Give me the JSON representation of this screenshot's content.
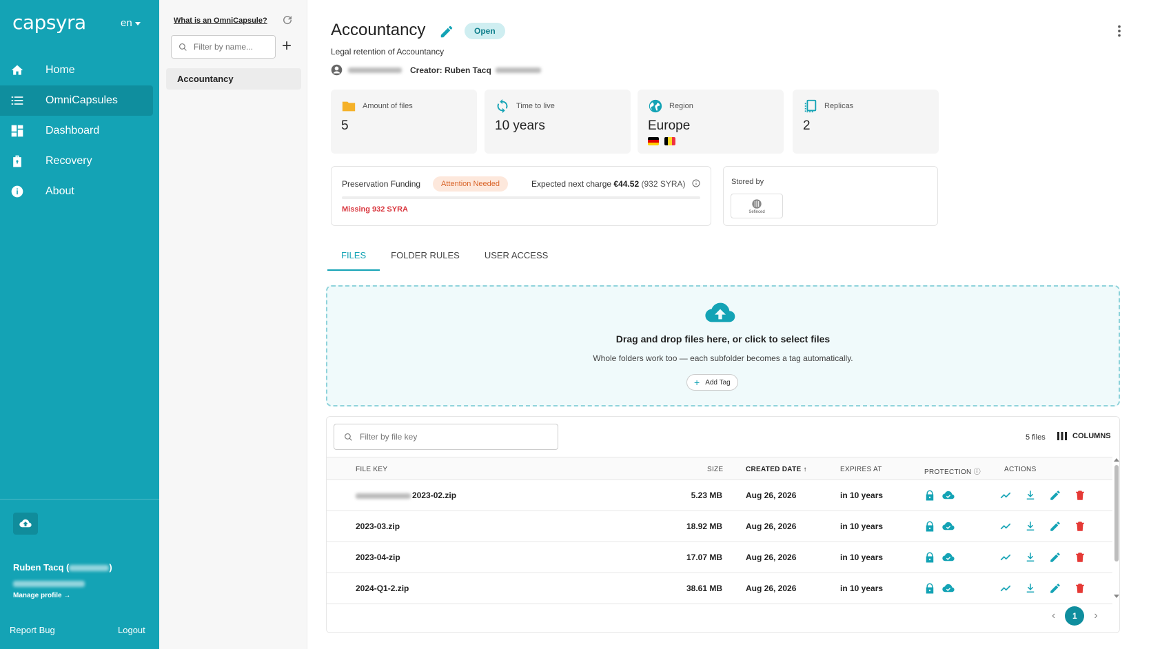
{
  "sidebar": {
    "logo": "capsyra",
    "lang": "en",
    "items": [
      {
        "label": "Home",
        "icon": "home-icon"
      },
      {
        "label": "OmniCapsules",
        "icon": "list-icon",
        "active": true
      },
      {
        "label": "Dashboard",
        "icon": "dashboard-icon"
      },
      {
        "label": "Recovery",
        "icon": "recovery-icon"
      },
      {
        "label": "About",
        "icon": "info-icon"
      }
    ],
    "user_name": "Ruben Tacq (",
    "user_name_end": ")",
    "manage_profile": "Manage profile →",
    "report_bug": "Report Bug",
    "logout": "Logout"
  },
  "capsules_panel": {
    "what_link": "What is an OmniCapsule?",
    "filter_placeholder": "Filter by name...",
    "items": [
      "Accountancy"
    ]
  },
  "capsule": {
    "title": "Accountancy",
    "status": "Open",
    "subtitle": "Legal retention of Accountancy",
    "creator": "Creator: Ruben Tacq",
    "stats": [
      {
        "label": "Amount of files",
        "value": "5",
        "icon": "folder-icon"
      },
      {
        "label": "Time to live",
        "value": "10 years",
        "icon": "refresh-icon"
      },
      {
        "label": "Region",
        "value": "Europe",
        "icon": "globe-icon"
      },
      {
        "label": "Replicas",
        "value": "2",
        "icon": "replicas-icon"
      }
    ],
    "region_flags": [
      "Germany",
      "Belgium"
    ],
    "funding": {
      "label": "Preservation Funding",
      "badge": "Attention Needed",
      "expected_label": "Expected next charge",
      "expected_amount": "€44.52",
      "expected_syra": "(932 SYRA)",
      "missing": "Missing 932 SYRA",
      "funded_fraction": 0
    },
    "stored_by": {
      "label": "Stored by",
      "provider": "Sefinced"
    }
  },
  "tabs": [
    "FILES",
    "FOLDER RULES",
    "USER ACCESS"
  ],
  "dropzone": {
    "title": "Drag and drop files here, or click to select files",
    "subtitle": "Whole folders work too — each subfolder becomes a tag automatically.",
    "add_tag": "Add Tag"
  },
  "files": {
    "filter_placeholder": "Filter by file key",
    "count": "5 files",
    "columns_label": "COLUMNS",
    "headers": {
      "key": "FILE KEY",
      "size": "SIZE",
      "created": "CREATED DATE",
      "expires": "EXPIRES AT",
      "protection": "PROTECTION",
      "actions": "ACTIONS"
    },
    "rows": [
      {
        "key": "2023-02.zip",
        "size": "5.23 MB",
        "created": "Aug 26, 2026",
        "expires": "in 10 years"
      },
      {
        "key": "2023-03.zip",
        "size": "18.92 MB",
        "created": "Aug 26, 2026",
        "expires": "in 10 years"
      },
      {
        "key": "2023-04-zip",
        "size": "17.07 MB",
        "created": "Aug 26, 2026",
        "expires": "in 10 years"
      },
      {
        "key": "2024-Q1-2.zip",
        "size": "38.61 MB",
        "created": "Aug 26, 2026",
        "expires": "in 10 years"
      }
    ],
    "page": "1"
  },
  "colors": {
    "accent": "#14a3b5",
    "danger": "#d9363e",
    "warning": "#d9652a"
  }
}
